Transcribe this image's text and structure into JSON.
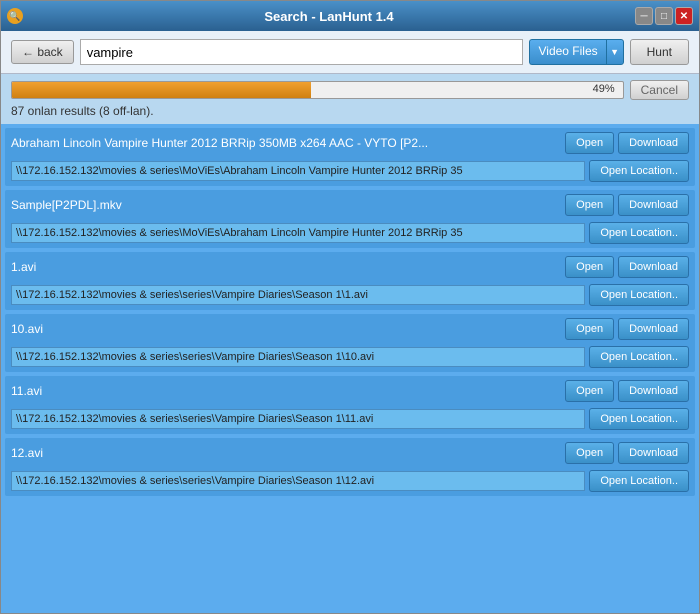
{
  "window": {
    "title": "Search - LanHunt 1.4",
    "controls": {
      "minimize": "─",
      "maximize": "□",
      "close": "✕"
    }
  },
  "toolbar": {
    "back_label": "← back",
    "search_value": "vampire",
    "filetype_label": "Video Files",
    "hunt_label": "Hunt"
  },
  "progress": {
    "percent": "49%",
    "fill_width": "49%",
    "cancel_label": "Cancel",
    "results_count": "87 onlan results (8 off-lan)."
  },
  "results": [
    {
      "filename": "Abraham Lincoln Vampire Hunter 2012 BRRip 350MB x264 AAC - VYTO [P2...",
      "path": "\\\\172.16.152.132\\movies & series\\MoViEs\\Abraham Lincoln Vampire Hunter 2012 BRRip 35",
      "open_label": "Open",
      "download_label": "Download",
      "open_location_label": "Open Location.."
    },
    {
      "filename": "Sample[P2PDL].mkv",
      "path": "\\\\172.16.152.132\\movies & series\\MoViEs\\Abraham Lincoln Vampire Hunter 2012 BRRip 35",
      "open_label": "Open",
      "download_label": "Download",
      "open_location_label": "Open Location.."
    },
    {
      "filename": "1.avi",
      "path": "\\\\172.16.152.132\\movies & series\\series\\Vampire Diaries\\Season 1\\1.avi",
      "open_label": "Open",
      "download_label": "Download",
      "open_location_label": "Open Location.."
    },
    {
      "filename": "10.avi",
      "path": "\\\\172.16.152.132\\movies & series\\series\\Vampire Diaries\\Season 1\\10.avi",
      "open_label": "Open",
      "download_label": "Download",
      "open_location_label": "Open Location.."
    },
    {
      "filename": "11.avi",
      "path": "\\\\172.16.152.132\\movies & series\\series\\Vampire Diaries\\Season 1\\11.avi",
      "open_label": "Open",
      "download_label": "Download",
      "open_location_label": "Open Location.."
    },
    {
      "filename": "12.avi",
      "path": "\\\\172.16.152.132\\movies & series\\series\\Vampire Diaries\\Season 1\\12.avi",
      "open_label": "Open",
      "download_label": "Download",
      "open_location_label": "Open Location.."
    }
  ]
}
